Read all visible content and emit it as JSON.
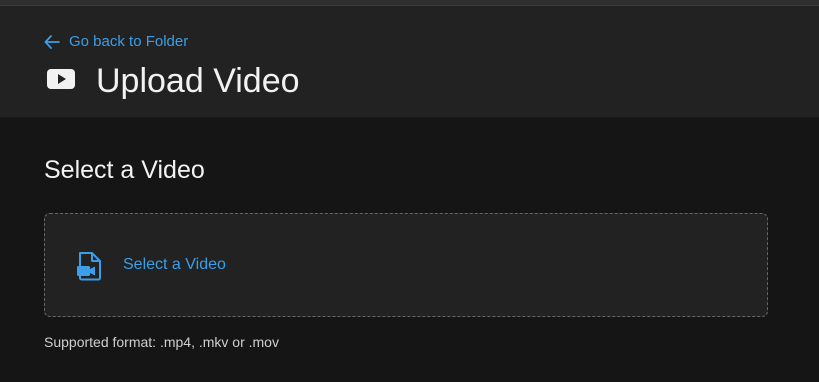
{
  "header": {
    "back_label": "Go back to Folder",
    "title": "Upload Video",
    "title_icon": "youtube-play-icon",
    "back_icon": "arrow-left-icon"
  },
  "main": {
    "section_title": "Select a Video",
    "dropzone": {
      "icon": "video-file-icon",
      "label": "Select a Video"
    },
    "format_note": "Supported format: .mp4, .mkv or .mov"
  },
  "colors": {
    "accent": "#3a9fe8",
    "background": "#151515",
    "header_background": "#222222",
    "text": "#f2f2f2"
  }
}
